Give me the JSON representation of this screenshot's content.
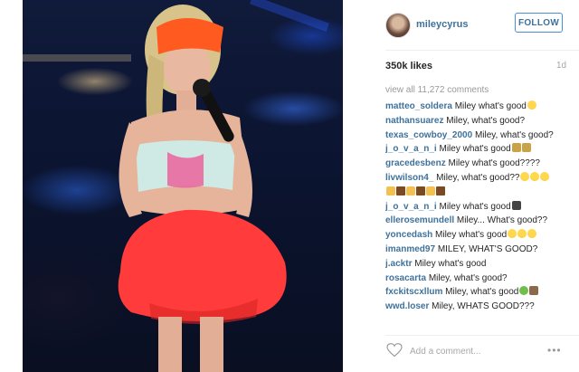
{
  "post": {
    "username": "mileycyrus",
    "follow_label": "FOLLOW",
    "likes": "350k likes",
    "age": "1d",
    "view_all": "view all 11,272 comments",
    "comments": [
      {
        "user": "matteo_soldera",
        "text": "Miley what's good",
        "emoji": [
          "laugh"
        ]
      },
      {
        "user": "nathansuarez",
        "text": "Miley, what's good?",
        "emoji": []
      },
      {
        "user": "texas_cowboy_2000",
        "text": "Miley, what's good?",
        "emoji": []
      },
      {
        "user": "j_o_v_a_n_i",
        "text": "Miley what's good",
        "emoji": [
          "money",
          "money"
        ]
      },
      {
        "user": "gracedesbenz",
        "text": "Miley what's good????",
        "emoji": []
      },
      {
        "user": "livwilson4_",
        "text": "Miley, what's good??",
        "emoji": [
          "laugh",
          "laugh",
          "laugh"
        ]
      },
      {
        "user": "",
        "text": "",
        "emoji": [
          "nail",
          "brown",
          "nail",
          "brown",
          "nail",
          "brown"
        ]
      },
      {
        "user": "j_o_v_a_n_i",
        "text": "Miley what's good",
        "emoji": [
          "watch"
        ]
      },
      {
        "user": "ellerosemundell",
        "text": "Miley... What's good??",
        "emoji": []
      },
      {
        "user": "yoncedash",
        "text": "Miley what's good",
        "emoji": [
          "laugh",
          "laugh",
          "laugh"
        ]
      },
      {
        "user": "imanmed97",
        "text": "MILEY, WHAT'S GOOD?",
        "emoji": []
      },
      {
        "user": "j.acktr",
        "text": "Miley what's good",
        "emoji": []
      },
      {
        "user": "rosacarta",
        "text": "Miley, what's good?",
        "emoji": []
      },
      {
        "user": "fxckitscxllum",
        "text": "Miley, what's good",
        "emoji": [
          "frog",
          "cup"
        ]
      },
      {
        "user": "wwd.loser",
        "text": "Miley, WHATS GOOD???",
        "emoji": []
      }
    ],
    "add_comment_placeholder": "Add a comment...",
    "more_icon": "•••"
  }
}
